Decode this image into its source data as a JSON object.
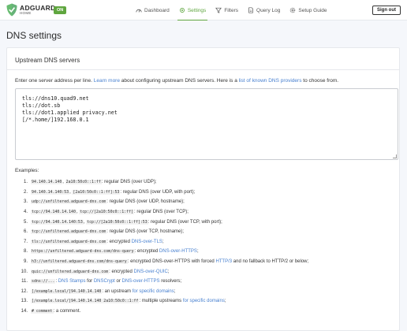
{
  "logo": {
    "title": "ADGUARD",
    "subtitle": "HOME"
  },
  "status_badge": "ON",
  "nav": [
    {
      "label": "Dashboard",
      "icon": "dashboard-icon"
    },
    {
      "label": "Settings",
      "icon": "settings-icon",
      "active": true
    },
    {
      "label": "Filters",
      "icon": "filter-icon"
    },
    {
      "label": "Query Log",
      "icon": "document-icon"
    },
    {
      "label": "Setup Guide",
      "icon": "gear-icon"
    }
  ],
  "sign_out": "Sign out",
  "page_title": "DNS settings",
  "card_title": "Upstream DNS servers",
  "description": {
    "pre": "Enter one server address per line. ",
    "link1": "Learn more",
    "mid": " about configuring upstream DNS servers. Here is a ",
    "link2": "list of known DNS providers",
    "post": " to choose from."
  },
  "upstream_text": "tls://dns10.quad9.net\ntls://dot.sb\ntls://dot1.applied privacy.net\n[/*.home/]192.168.0.1",
  "examples_label": "Examples:",
  "examples": [
    {
      "n": "1.",
      "c1": "94.140.14.140",
      "s1": ", ",
      "c2": "2a10:50c0::1:ff",
      "t": ": regular DNS (over UDP);"
    },
    {
      "n": "2.",
      "c1": "94.140.14.140:53",
      "s1": ", ",
      "c2": "[2a10:50c0::1:ff]:53",
      "t": ": regular DNS (over UDP, with port);"
    },
    {
      "n": "3.",
      "c1": "udp://unfiltered.adguard-dns.com",
      "t": ": regular DNS (over UDP, hostname);"
    },
    {
      "n": "4.",
      "c1": "tcp://94.140.14.140",
      "s1": ", ",
      "c2": "tcp://[2a10:50c0::1:ff]",
      "t": ": regular DNS (over TCP);"
    },
    {
      "n": "5.",
      "c1": "tcp://94.140.14.140:53",
      "s1": ", ",
      "c2": "tcp://[2a10:50c0::1:ff]:53",
      "t": ": regular DNS (over TCP, with port);"
    },
    {
      "n": "6.",
      "c1": "tcp://unfiltered.adguard-dns.com",
      "t": ": regular DNS (over TCP, hostname);"
    },
    {
      "n": "7.",
      "c1": "tls://unfiltered.adguard-dns.com",
      "t": ": encrypted ",
      "l1": "DNS-over-TLS",
      "t2": ";"
    },
    {
      "n": "8.",
      "c1": "https://unfiltered.adguard-dns.com/dns-query",
      "t": ": encrypted ",
      "l1": "DNS-over-HTTPS",
      "t2": ";"
    },
    {
      "n": "9.",
      "c1": "h3://unfiltered.adguard-dns.com/dns-query",
      "t": ": encrypted DNS-over-HTTPS with forced ",
      "l1": "HTTP/3",
      "t2": " and no fallback to HTTP/2 or below;"
    },
    {
      "n": "10.",
      "c1": "quic://unfiltered.adguard-dns.com",
      "t": ": encrypted ",
      "l1": "DNS-over-QUIC",
      "t2": ";"
    },
    {
      "n": "11.",
      "c1": "sdns://...",
      "t": ": ",
      "l1": "DNS Stamps",
      "t2": " for ",
      "l2": "DNSCrypt",
      "t3": " or ",
      "l3": "DNS-over-HTTPS",
      "t4": " resolvers;"
    },
    {
      "n": "12.",
      "c1": "[/example.local/]94.140.14.140",
      "t": ": an upstream ",
      "l1": "for specific domains",
      "t2": ";"
    },
    {
      "n": "13.",
      "c1": "[/example.local/]94.140.14.140 2a10:50c0::1:ff",
      "t": ": multiple upstreams ",
      "l1": "for specific domains",
      "t2": ";"
    },
    {
      "n": "14.",
      "c1": "# comment",
      "t": ": a comment."
    }
  ],
  "colors": {
    "accent": "#5fa63f",
    "link": "#467fcf"
  }
}
